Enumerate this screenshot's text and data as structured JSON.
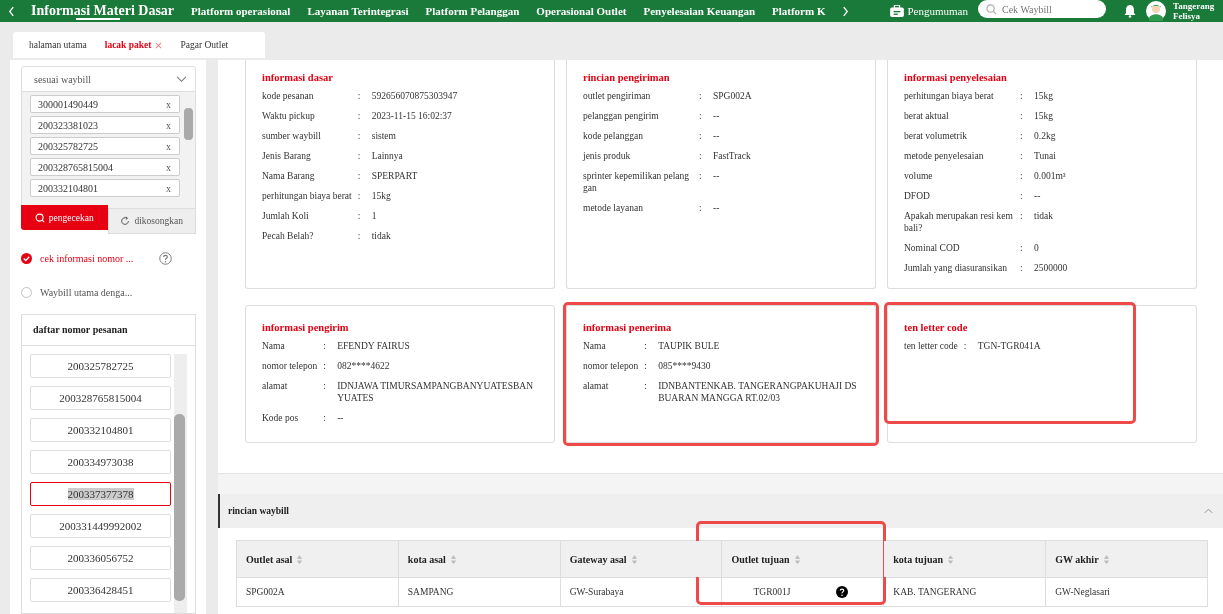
{
  "nav": {
    "items": [
      {
        "label": "Informasi Materi Dasar",
        "selected": true
      },
      {
        "label": "Platform operasional",
        "selected": false
      },
      {
        "label": "Layanan Terintegrasi",
        "selected": false
      },
      {
        "label": "Platform Pelanggan",
        "selected": false
      },
      {
        "label": "Operasional Outlet",
        "selected": false
      },
      {
        "label": "Penyelesaian Keuangan",
        "selected": false
      },
      {
        "label": "Platform K",
        "selected": false
      }
    ],
    "announcement": "Pengumuman",
    "search": {
      "placeholder": "Cek Waybill"
    },
    "user": {
      "outlet": "Tangerang",
      "name": "Felisya"
    }
  },
  "tabs": [
    {
      "label": "halaman utama",
      "selected": false,
      "closable": false
    },
    {
      "label": "lacak paket",
      "selected": true,
      "closable": true
    },
    {
      "label": "Pagar Outlet",
      "selected": false,
      "closable": false
    }
  ],
  "sidebar": {
    "select": {
      "value": "sesuai waybill"
    },
    "tags": [
      {
        "label": "300001490449",
        "remove": "x"
      },
      {
        "label": "200323381023",
        "remove": "x"
      },
      {
        "label": "200325782725",
        "remove": "x"
      },
      {
        "label": "200328765815004",
        "remove": "x"
      },
      {
        "label": "200332104801",
        "remove": "x"
      }
    ],
    "buttons": [
      {
        "kind": "search",
        "label": "pengecekan"
      },
      {
        "kind": "reset",
        "label": "dikosongkan"
      }
    ],
    "options": [
      {
        "label": "cek informasi nomor ...",
        "selected": true,
        "help": true
      },
      {
        "label": "Waybill utama denga...",
        "selected": false,
        "help": false
      }
    ],
    "list": {
      "title": "daftar nomor pesanan",
      "items": [
        {
          "label": "200325782725",
          "selected": false
        },
        {
          "label": "200328765815004",
          "selected": false
        },
        {
          "label": "200332104801",
          "selected": false
        },
        {
          "label": "200334973038",
          "selected": false
        },
        {
          "label": "200337377378",
          "selected": true
        },
        {
          "label": "200331449992002",
          "selected": false
        },
        {
          "label": "200336056752",
          "selected": false
        },
        {
          "label": "200336428451",
          "selected": false
        }
      ]
    }
  },
  "cards": [
    {
      "title": "informasi dasar",
      "highlighted": false,
      "rows": [
        {
          "label": "kode pesanan",
          "sep": ":",
          "value": "592656070875303947"
        },
        {
          "label": "Waktu pickup",
          "sep": ":",
          "value": "2023-11-15 16:02:37"
        },
        {
          "label": "sumber waybill",
          "sep": ":",
          "value": "sistem"
        },
        {
          "label": "Jenis Barang",
          "sep": ":",
          "value": "Lainnya"
        },
        {
          "label": "Nama Barang",
          "sep": ":",
          "value": "SPERPART"
        },
        {
          "label": "perhitungan biaya berat",
          "sep": ":",
          "value": "15kg"
        },
        {
          "label": "Jumlah Koli",
          "sep": ":",
          "value": "1"
        },
        {
          "label": "Pecah Belah?",
          "sep": ":",
          "value": "tidak"
        }
      ]
    },
    {
      "title": "rincian pengiriman",
      "highlighted": false,
      "rows": [
        {
          "label": "outlet pengiriman",
          "sep": ":",
          "value": "SPG002A"
        },
        {
          "label": "pelanggan pengirim",
          "sep": ":",
          "value": "--"
        },
        {
          "label": "kode pelanggan",
          "sep": ":",
          "value": "--"
        },
        {
          "label": "jenis produk",
          "sep": ":",
          "value": "FastTrack"
        },
        {
          "label": "sprinter kepemilikan pelanggan",
          "sep": ":",
          "value": "--"
        },
        {
          "label": "metode layanan",
          "sep": ":",
          "value": "--"
        }
      ]
    },
    {
      "title": "informasi penyelesaian",
      "highlighted": false,
      "rows": [
        {
          "label": "perhitungan biaya berat",
          "sep": ":",
          "value": "15kg"
        },
        {
          "label": "berat aktual",
          "sep": ":",
          "value": "15kg"
        },
        {
          "label": "berat volumetrik",
          "sep": ":",
          "value": "0.2kg"
        },
        {
          "label": "metode penyelesaian",
          "sep": ":",
          "value": "Tunai"
        },
        {
          "label": "volume",
          "sep": ":",
          "value": "0.001m³"
        },
        {
          "label": "DFOD",
          "sep": ":",
          "value": "--"
        },
        {
          "label": "Apakah merupakan resi kembali?",
          "sep": ":",
          "value": "tidak"
        },
        {
          "label": "Nominal COD",
          "sep": ":",
          "value": "0"
        },
        {
          "label": "Jumlah yang diasuransikan",
          "sep": ":",
          "value": "2500000"
        }
      ]
    },
    {
      "title": "informasi pengirim",
      "highlighted": false,
      "rows": [
        {
          "label": "Nama",
          "sep": ":",
          "value": "EFENDY FAIRUS"
        },
        {
          "label": "nomor telepon",
          "sep": ":",
          "value": "082****4622"
        },
        {
          "label": "alamat",
          "sep": ":",
          "value": "IDNJAWA TIMURSAMPANGBANYUATESBANYUATES"
        },
        {
          "label": "Kode pos",
          "sep": ":",
          "value": "--"
        }
      ]
    },
    {
      "title": "informasi penerima",
      "highlighted": true,
      "rows": [
        {
          "label": "Nama",
          "sep": ":",
          "value": "TAUPIK BULE"
        },
        {
          "label": "nomor telepon",
          "sep": ":",
          "value": "085****9430"
        },
        {
          "label": "alamat",
          "sep": ":",
          "value": "IDNBANTENKAB. TANGERANGPAKUHAJI DS BUARAN MANGGA RT.02/03"
        }
      ]
    },
    {
      "title": "ten letter code",
      "highlighted": true,
      "rows": [
        {
          "label": "ten letter code",
          "sep": ":",
          "value": "TGN-TGR041A"
        }
      ]
    }
  ],
  "waybill": {
    "title": "rincian waybill",
    "expanded": true,
    "columns": [
      {
        "label": "Outlet asal",
        "highlighted": false
      },
      {
        "label": "kota asal",
        "highlighted": false
      },
      {
        "label": "Gateway asal",
        "highlighted": false
      },
      {
        "label": "Outlet tujuan",
        "highlighted": true
      },
      {
        "label": "kota tujuan",
        "highlighted": false
      },
      {
        "label": "GW akhir",
        "highlighted": false
      }
    ],
    "rows": [
      {
        "cells": [
          {
            "text": "SPG002A",
            "help": false
          },
          {
            "text": "SAMPANG",
            "help": false
          },
          {
            "text": "GW-Surabaya",
            "help": false
          },
          {
            "text": "TGR001J",
            "help": true
          },
          {
            "text": "KAB. TANGERANG",
            "help": false
          },
          {
            "text": "GW-Neglasari",
            "help": false
          }
        ]
      }
    ]
  }
}
